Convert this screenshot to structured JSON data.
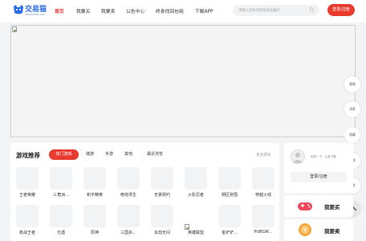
{
  "header": {
    "logo_text": "交易猫",
    "logo_sub": "jiaoyimao.com",
    "nav": [
      "首页",
      "我要买",
      "我要卖",
      "公告中心",
      "终身找回包赔",
      "下载APP"
    ],
    "active_nav": 0,
    "search_placeholder": "请输入游戏名称或商品编码",
    "login_label": "登录/注册"
  },
  "side_float": [
    "客服",
    "消息",
    "收藏",
    "足迹",
    "分类"
  ],
  "games": {
    "title": "游戏推荐",
    "tabs": [
      "热门游戏",
      "端游",
      "手游",
      "其他",
      "最近浏览"
    ],
    "active_tab": 0,
    "more": "更多游戏",
    "items": [
      "王者荣耀",
      "三角洲...",
      "和平精英",
      "绝地求生",
      "无畏契约",
      "火影忍者",
      "朔区突围",
      "穿越火线",
      "枪战王者",
      "光遇",
      "原神",
      "三国杀...",
      "永劫无间",
      "英雄联盟",
      "金铲铲...",
      "PUBGM..."
    ]
  },
  "user_card": {
    "welcome": "欢迎一下，让我了解",
    "register_label": "登录/注册"
  },
  "actions": [
    "我要买",
    "我要卖"
  ],
  "colors": {
    "accent": "#e93a2f",
    "logo": "#2b6de8"
  }
}
